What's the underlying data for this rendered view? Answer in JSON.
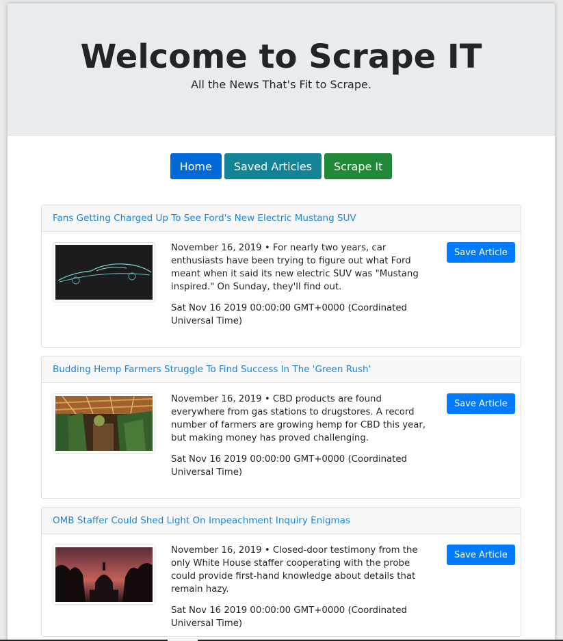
{
  "jumbotron": {
    "title": "Welcome to Scrape IT",
    "subtitle": "All the News That's Fit to Scrape."
  },
  "nav": {
    "home": "Home",
    "saved": "Saved Articles",
    "scrape": "Scrape It"
  },
  "articles": [
    {
      "title": "Fans Getting Charged Up To See Ford's New Electric Mustang SUV",
      "summary": "November 16, 2019 • For nearly two years, car enthusiasts have been trying to figure out what Ford meant when it said its new electric SUV was \"Mustang inspired.\" On Sunday, they'll find out.",
      "date": "Sat Nov 16 2019 00:00:00 GMT+0000 (Coordinated Universal Time)",
      "save_label": "Save Article"
    },
    {
      "title": "Budding Hemp Farmers Struggle To Find Success In The 'Green Rush'",
      "summary": "November 16, 2019 • CBD products are found everywhere from gas stations to drugstores. A record number of farmers are growing hemp for CBD this year, but making money has proved challenging.",
      "date": "Sat Nov 16 2019 00:00:00 GMT+0000 (Coordinated Universal Time)",
      "save_label": "Save Article"
    },
    {
      "title": "OMB Staffer Could Shed Light On Impeachment Inquiry Enigmas",
      "summary": "November 16, 2019 • Closed-door testimony from the only White House staffer cooperating with the probe could provide first-hand knowledge about details that remain hazy.",
      "date": "Sat Nov 16 2019 00:00:00 GMT+0000 (Coordinated Universal Time)",
      "save_label": "Save Article"
    }
  ]
}
